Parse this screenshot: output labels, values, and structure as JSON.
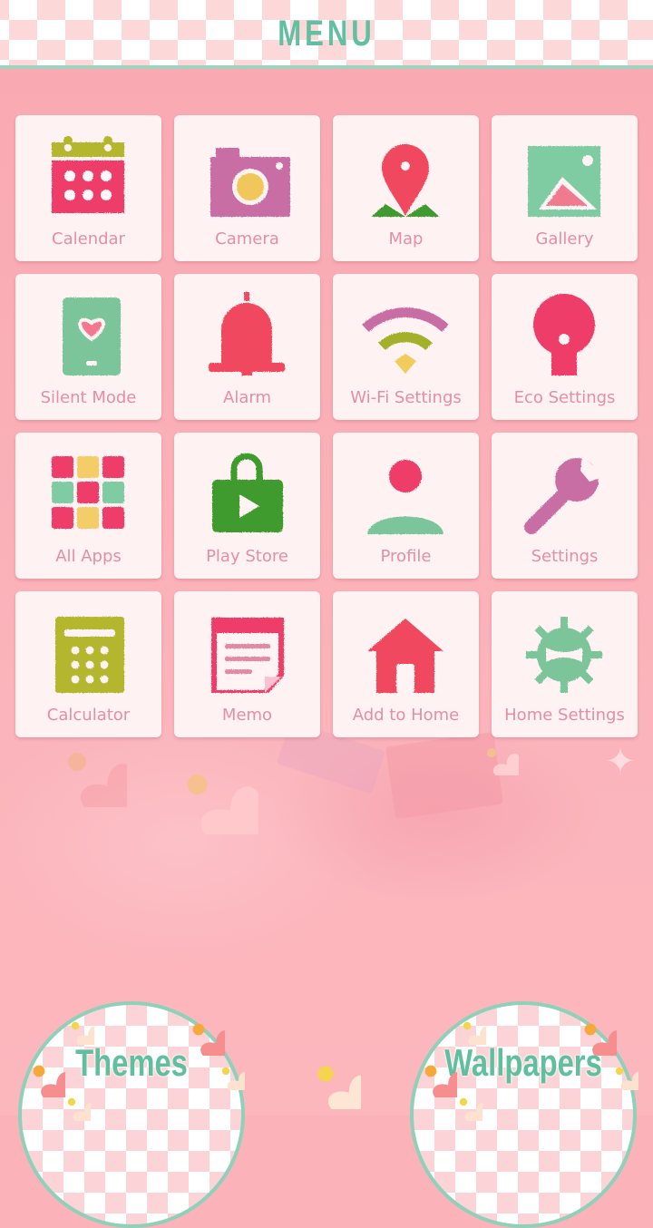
{
  "header": {
    "title": "MENU"
  },
  "colors": {
    "background": "#fbb3b9",
    "accent_teal": "#63bfa1",
    "label_pink": "#e38fa4",
    "tile_bg": "#fff2f3"
  },
  "menu": {
    "items": [
      {
        "label": "Calendar",
        "icon": "calendar-icon"
      },
      {
        "label": "Camera",
        "icon": "camera-icon"
      },
      {
        "label": "Map",
        "icon": "map-pin-icon"
      },
      {
        "label": "Gallery",
        "icon": "gallery-icon"
      },
      {
        "label": "Silent Mode",
        "icon": "silent-mode-phone-icon"
      },
      {
        "label": "Alarm",
        "icon": "bell-icon"
      },
      {
        "label": "Wi-Fi Settings",
        "icon": "wifi-icon"
      },
      {
        "label": "Eco Settings",
        "icon": "bulb-icon"
      },
      {
        "label": "All Apps",
        "icon": "app-grid-icon"
      },
      {
        "label": "Play Store",
        "icon": "store-bag-icon"
      },
      {
        "label": "Profile",
        "icon": "person-icon"
      },
      {
        "label": "Settings",
        "icon": "wrench-icon"
      },
      {
        "label": "Calculator",
        "icon": "calculator-icon"
      },
      {
        "label": "Memo",
        "icon": "memo-icon"
      },
      {
        "label": "Add to Home",
        "icon": "house-icon"
      },
      {
        "label": "Home Settings",
        "icon": "gear-icon"
      }
    ]
  },
  "footer": {
    "themes_label": "Themes",
    "wallpapers_label": "Wallpapers"
  }
}
